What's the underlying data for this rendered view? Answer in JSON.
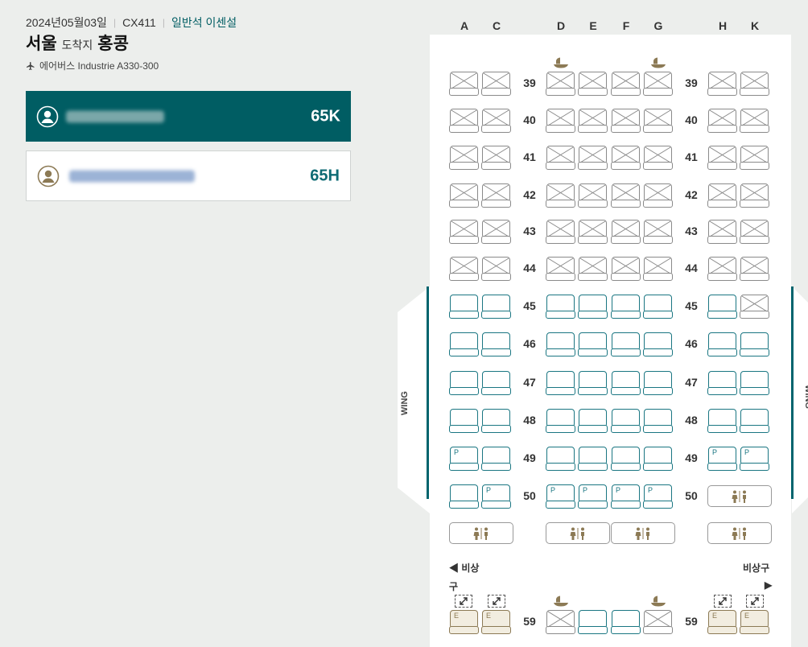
{
  "header": {
    "date": "2024년05월03일",
    "flight": "CX411",
    "cabin": "일반석 이센설",
    "origin": "서울",
    "arrow_text": "도착지",
    "destination": "홍콩",
    "aircraft": "에어버스 Industrie A330-300"
  },
  "passengers": [
    {
      "name": "",
      "seat": "65K",
      "selected": true
    },
    {
      "name": "",
      "seat": "65H",
      "selected": false
    }
  ],
  "seatmap": {
    "columns": [
      "A",
      "C",
      "D",
      "E",
      "F",
      "G",
      "H",
      "K"
    ],
    "rows": [
      {
        "num": "39",
        "seats": {
          "A": "occupied",
          "C": "occupied",
          "D": "occupied",
          "E": "occupied",
          "F": "occupied",
          "G": "occupied",
          "H": "occupied",
          "K": "occupied"
        },
        "bassinets": [
          "D",
          "G"
        ]
      },
      {
        "num": "40",
        "seats": {
          "A": "occupied",
          "C": "occupied",
          "D": "occupied",
          "E": "occupied",
          "F": "occupied",
          "G": "occupied",
          "H": "occupied",
          "K": "occupied"
        }
      },
      {
        "num": "41",
        "seats": {
          "A": "occupied",
          "C": "occupied",
          "D": "occupied",
          "E": "occupied",
          "F": "occupied",
          "G": "occupied",
          "H": "occupied",
          "K": "occupied"
        }
      },
      {
        "num": "42",
        "seats": {
          "A": "occupied",
          "C": "occupied",
          "D": "occupied",
          "E": "occupied",
          "F": "occupied",
          "G": "occupied",
          "H": "occupied",
          "K": "occupied"
        }
      },
      {
        "num": "43",
        "seats": {
          "A": "occupied",
          "C": "occupied",
          "D": "occupied",
          "E": "occupied",
          "F": "occupied",
          "G": "occupied",
          "H": "occupied",
          "K": "occupied"
        }
      },
      {
        "num": "44",
        "seats": {
          "A": "occupied",
          "C": "occupied",
          "D": "occupied",
          "E": "occupied",
          "F": "occupied",
          "G": "occupied",
          "H": "occupied",
          "K": "occupied"
        }
      },
      {
        "num": "45",
        "seats": {
          "A": "free",
          "C": "free",
          "D": "free",
          "E": "free",
          "F": "free",
          "G": "free",
          "H": "free",
          "K": "occupied"
        }
      },
      {
        "num": "46",
        "seats": {
          "A": "free",
          "C": "free",
          "D": "free",
          "E": "free",
          "F": "free",
          "G": "free",
          "H": "free",
          "K": "free"
        }
      },
      {
        "num": "47",
        "seats": {
          "A": "free",
          "C": "free",
          "D": "free",
          "E": "free",
          "F": "free",
          "G": "free",
          "H": "free",
          "K": "free"
        }
      },
      {
        "num": "48",
        "seats": {
          "A": "free",
          "C": "free",
          "D": "free",
          "E": "free",
          "F": "free",
          "G": "free",
          "H": "free",
          "K": "free"
        }
      },
      {
        "num": "49",
        "seats": {
          "A": "P",
          "C": "free",
          "D": "free",
          "E": "free",
          "F": "free",
          "G": "free",
          "H": "P",
          "K": "P"
        }
      },
      {
        "num": "50",
        "seats": {
          "A": "free",
          "C": "P",
          "D": "P",
          "E": "P",
          "F": "P",
          "G": "P"
        },
        "lavatory_right": true
      },
      {
        "num": "59",
        "seats": {
          "A": "E",
          "C": "E",
          "D": "occupied",
          "E": "free",
          "F": "free",
          "G": "occupied",
          "H": "E",
          "K": "E"
        },
        "bassinets": [
          "D",
          "G"
        ]
      }
    ],
    "premium_label": "P",
    "exit_row_label": "E",
    "wing_label": "WING",
    "exit_left": "◀ 비상",
    "exit_left_cont": "구",
    "exit_right": "비상구",
    "exit_right_arrow": "▶"
  }
}
